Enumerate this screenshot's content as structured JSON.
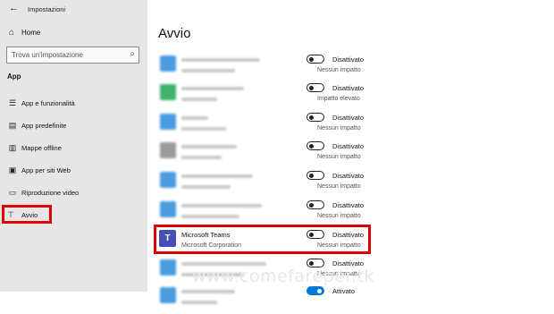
{
  "window": {
    "title": "Impostazioni"
  },
  "sidebar": {
    "home_label": "Home",
    "search_placeholder": "Trova un'impostazione",
    "section_label": "App",
    "items": [
      {
        "label": "App e funzionalità",
        "icon": "list-icon"
      },
      {
        "label": "App predefinite",
        "icon": "default-apps-icon"
      },
      {
        "label": "Mappe offline",
        "icon": "map-icon"
      },
      {
        "label": "App per siti Web",
        "icon": "web-link-icon"
      },
      {
        "label": "Riproduzione video",
        "icon": "video-icon"
      },
      {
        "label": "Avvio",
        "icon": "startup-icon",
        "active": true
      }
    ]
  },
  "main": {
    "title": "Avvio",
    "rows": [
      {
        "state": "Disattivato",
        "impact": "Nessun impatto",
        "on": false,
        "icon_color": "#4a9be0",
        "blurred": true
      },
      {
        "state": "Disattivato",
        "impact": "Impatto elevato",
        "on": false,
        "icon_color": "#3fb36a",
        "blurred": true
      },
      {
        "state": "Disattivato",
        "impact": "Nessun impatto",
        "on": false,
        "icon_color": "#4a9be0",
        "blurred": true
      },
      {
        "state": "Disattivato",
        "impact": "Nessun impatto",
        "on": false,
        "icon_color": "#9a9a9a",
        "blurred": true
      },
      {
        "state": "Disattivato",
        "impact": "Nessun impatto",
        "on": false,
        "icon_color": "#4a9be0",
        "blurred": true
      },
      {
        "state": "Disattivato",
        "impact": "Nessun impatto",
        "on": false,
        "icon_color": "#4a9be0",
        "blurred": true
      },
      {
        "name": "Microsoft Teams",
        "publisher": "Microsoft Corporation",
        "state": "Disattivato",
        "impact": "Nessun impatto",
        "on": false,
        "icon_color": "#464eb8",
        "icon_letter": "T",
        "blurred": false
      },
      {
        "state": "Disattivato",
        "impact": "Nessun impatto",
        "on": false,
        "icon_color": "#4a9be0",
        "blurred": true
      },
      {
        "state": "Attivato",
        "impact": "",
        "on": true,
        "icon_color": "#4a9be0",
        "blurred": true
      }
    ]
  },
  "watermark": "www.comefareper.tk",
  "colors": {
    "highlight": "#e00000",
    "toggle_on": "#0078d7"
  }
}
